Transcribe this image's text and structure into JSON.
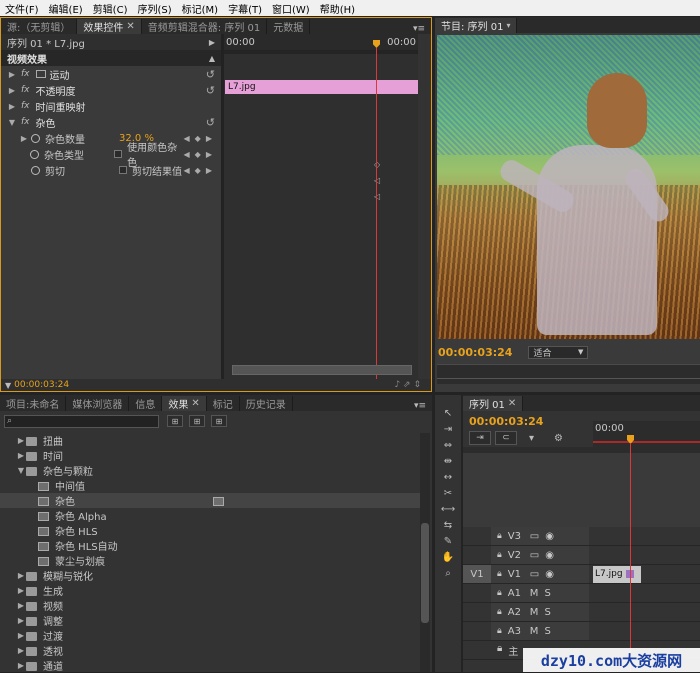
{
  "menubar": [
    "文件(F)",
    "编辑(E)",
    "剪辑(C)",
    "序列(S)",
    "标记(M)",
    "字幕(T)",
    "窗口(W)",
    "帮助(H)"
  ],
  "source_panel": {
    "tabs": [
      "源:（无剪辑）",
      "效果控件",
      "音频剪辑混合器: 序列 01",
      "元数据"
    ],
    "active_tab_index": 1
  },
  "effect_controls": {
    "clip_path": "序列 01 * L7.jpg",
    "section_title": "视频效果",
    "ruler_start": "00:00",
    "ruler_end": "00:00",
    "clip_label": "L7.jpg",
    "effects": [
      {
        "name": "运动",
        "has_icon": true
      },
      {
        "name": "不透明度"
      },
      {
        "name": "时间重映射"
      },
      {
        "name": "杂色",
        "expanded": true
      }
    ],
    "noise_params": [
      {
        "name": "杂色数量",
        "value": "32.0 %"
      },
      {
        "name": "杂色类型",
        "checkbox_label": "使用颜色杂色"
      },
      {
        "name": "剪切",
        "checkbox_label": "剪切结果值"
      }
    ],
    "timecode": "00:00:03:24"
  },
  "program_monitor": {
    "tab": "节目: 序列 01",
    "timecode": "00:00:03:24",
    "zoom": "适合"
  },
  "project_panel": {
    "tabs": [
      "项目:未命名",
      "媒体浏览器",
      "信息",
      "效果",
      "标记",
      "历史记录"
    ],
    "active_tab_index": 3,
    "search_placeholder": "",
    "tree": [
      {
        "label": "扭曲",
        "type": "folder",
        "level": 0
      },
      {
        "label": "时间",
        "type": "folder",
        "level": 0
      },
      {
        "label": "杂色与颗粒",
        "type": "folder",
        "level": 0,
        "open": true
      },
      {
        "label": "中间值",
        "type": "effect",
        "level": 1
      },
      {
        "label": "杂色",
        "type": "effect",
        "level": 1,
        "selected": true
      },
      {
        "label": "杂色 Alpha",
        "type": "effect",
        "level": 1
      },
      {
        "label": "杂色 HLS",
        "type": "effect",
        "level": 1
      },
      {
        "label": "杂色 HLS自动",
        "type": "effect",
        "level": 1
      },
      {
        "label": "蒙尘与划痕",
        "type": "effect",
        "level": 1
      },
      {
        "label": "模糊与锐化",
        "type": "folder",
        "level": 0
      },
      {
        "label": "生成",
        "type": "folder",
        "level": 0
      },
      {
        "label": "视频",
        "type": "folder",
        "level": 0
      },
      {
        "label": "调整",
        "type": "folder",
        "level": 0
      },
      {
        "label": "过渡",
        "type": "folder",
        "level": 0
      },
      {
        "label": "透视",
        "type": "folder",
        "level": 0
      },
      {
        "label": "通道",
        "type": "folder",
        "level": 0
      }
    ]
  },
  "timeline": {
    "tab": "序列 01",
    "timecode": "00:00:03:24",
    "ruler_start": "00:00",
    "tracks": [
      {
        "name": "V3",
        "kind": "video"
      },
      {
        "name": "V2",
        "kind": "video"
      },
      {
        "name": "V1",
        "kind": "video",
        "source": "V1",
        "clip": "L7.jpg"
      },
      {
        "name": "A1",
        "kind": "audio"
      },
      {
        "name": "A2",
        "kind": "audio"
      },
      {
        "name": "A3",
        "kind": "audio"
      }
    ],
    "master_label": "主"
  },
  "watermark": "dzy10.com大资源网"
}
